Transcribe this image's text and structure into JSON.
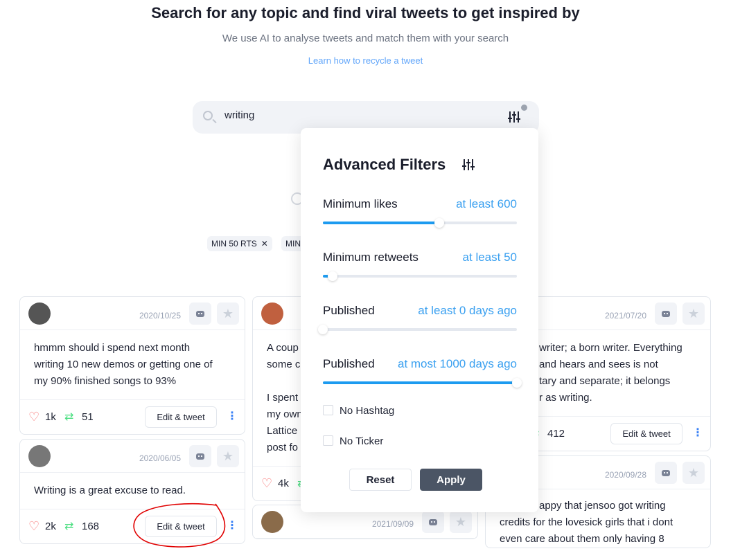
{
  "header": {
    "title": "Search for any topic and find viral tweets to get inspired by",
    "subtitle": "We use AI to analyse tweets and match them with your search",
    "learn_link": "Learn how to recycle a tweet"
  },
  "search": {
    "value": "writing"
  },
  "chips": [
    {
      "label": "MIN 50 RTS"
    },
    {
      "label": "MIN"
    }
  ],
  "card_actions": {
    "edit_label": "Edit & tweet"
  },
  "tweets": [
    {
      "date": "2020/10/25",
      "lines": [
        "hmmm should i spend next month",
        "writing 10 new demos or getting one of",
        "my 90% finished songs to 93%"
      ],
      "likes": "1k",
      "retweets": "51"
    },
    {
      "date": "2020/06/05",
      "lines": [
        "Writing is a great excuse to read."
      ],
      "likes": "2k",
      "retweets": "168"
    },
    {
      "date": "",
      "lines": [
        "A coup",
        "some c",
        "",
        "I spent",
        "my own",
        "Lattice",
        "post fo"
      ],
      "likes": "4k",
      "retweets": ""
    },
    {
      "date": "2021/09/09",
      "lines": [],
      "likes": "",
      "retweets": ""
    },
    {
      "date": "2021/07/20",
      "lines": [
        "writer; a born writer. Everything",
        "and hears and sees is not",
        "tary and separate; it belongs",
        "r as writing."
      ],
      "likes": "",
      "retweets": "412"
    },
    {
      "date": "2020/09/28",
      "lines": [
        "appy that jensoo got writing",
        "credits for the lovesick girls that i dont",
        "even care about them only having 8"
      ],
      "likes": "",
      "retweets": ""
    }
  ],
  "filters": {
    "title": "Advanced Filters",
    "min_likes": {
      "label": "Minimum likes",
      "value_text": "at least 600",
      "value": 600,
      "max": 1000
    },
    "min_retweets": {
      "label": "Minimum retweets",
      "value_text": "at least 50",
      "value": 50,
      "max": 1000
    },
    "published_min": {
      "label": "Published",
      "value_text": "at least 0 days ago",
      "value": 0,
      "max": 1000
    },
    "published_max": {
      "label": "Published",
      "value_text": "at most 1000 days ago",
      "value": 1000,
      "max": 1000
    },
    "no_hashtag": {
      "label": "No Hashtag",
      "checked": false
    },
    "no_ticker": {
      "label": "No Ticker",
      "checked": false
    },
    "reset_label": "Reset",
    "apply_label": "Apply"
  },
  "colors": {
    "accent": "#1d9bf0",
    "apply_bg": "#4b5565",
    "like": "#f87171",
    "retweet": "#4ade80",
    "annotation": "#e00000"
  }
}
